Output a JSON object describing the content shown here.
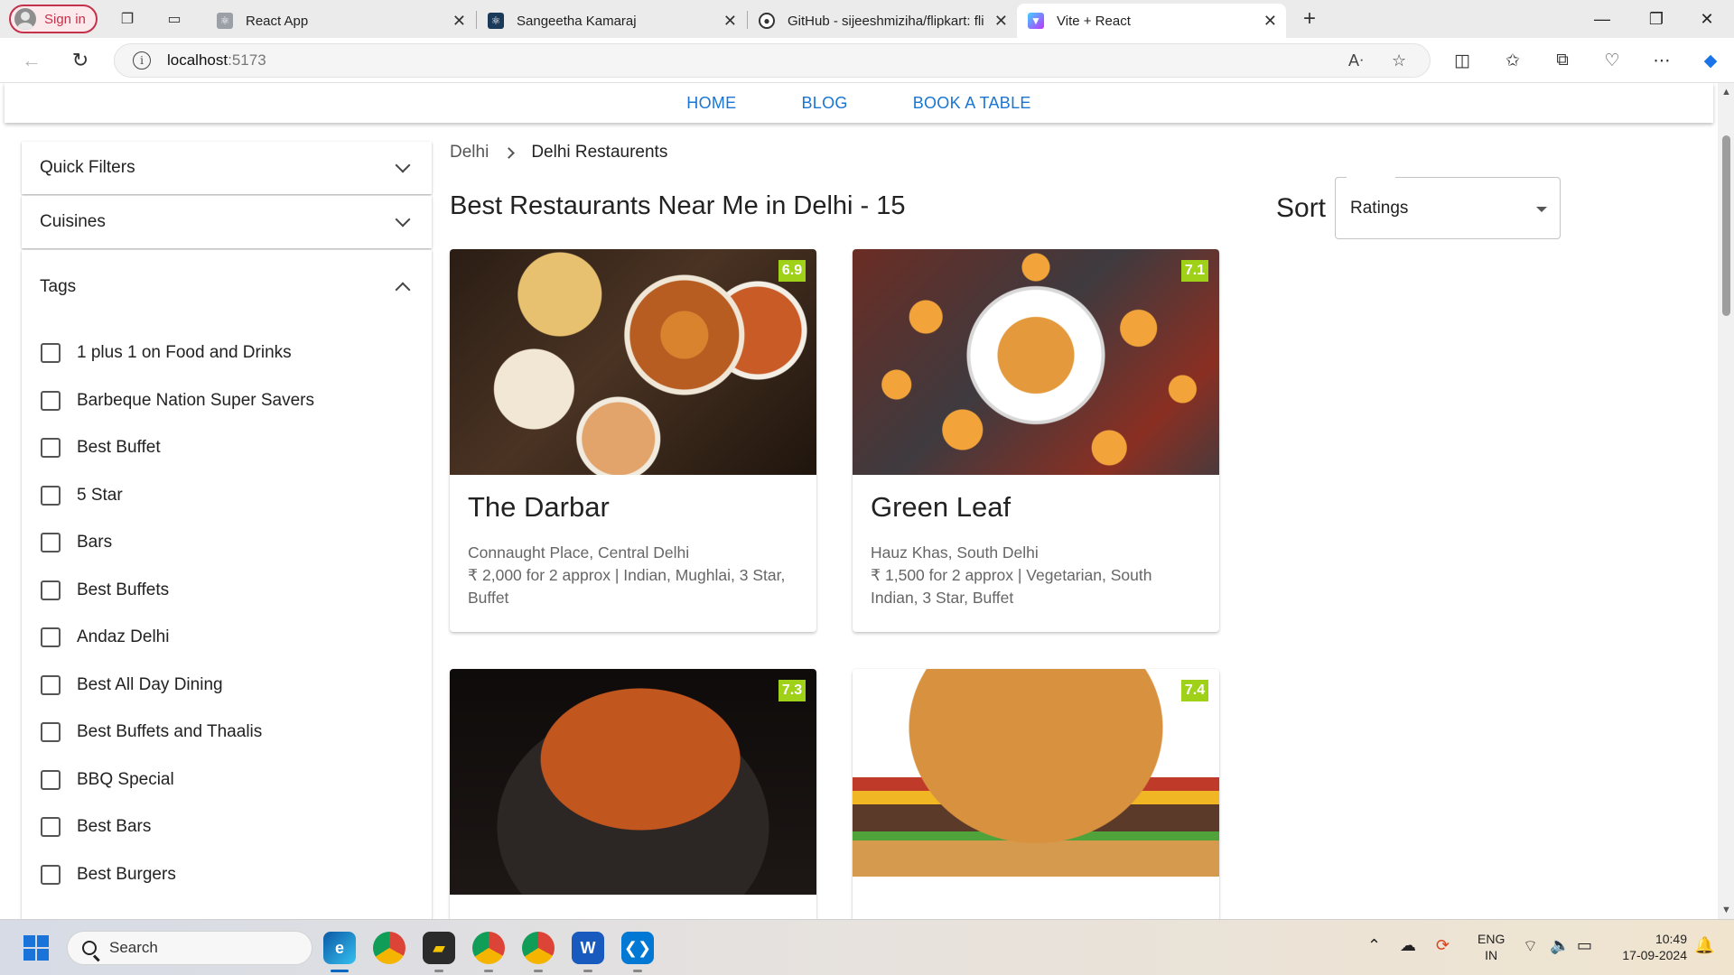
{
  "browser": {
    "signin_label": "Sign in",
    "tabs": [
      {
        "title": "React App"
      },
      {
        "title": "Sangeetha Kamaraj"
      },
      {
        "title": "GitHub - sijeeshmiziha/flipkart: fli"
      },
      {
        "title": "Vite + React"
      }
    ],
    "address_host": "localhost",
    "address_port": ":5173"
  },
  "nav": {
    "links": [
      "HOME",
      "BLOG",
      "BOOK A TABLE"
    ]
  },
  "sidebar": {
    "quick_filters": "Quick Filters",
    "cuisines": "Cuisines",
    "tags_title": "Tags",
    "tags": [
      "1 plus 1 on Food and Drinks",
      "Barbeque Nation Super Savers",
      "Best Buffet",
      "5 Star",
      "Bars",
      "Best Buffets",
      "Andaz Delhi",
      "Best All Day Dining",
      "Best Buffets and Thaalis",
      "BBQ Special",
      "Best Bars",
      "Best Burgers"
    ]
  },
  "main": {
    "breadcrumb": [
      "Delhi",
      "Delhi Restaurents"
    ],
    "heading": "Best Restaurants Near Me in Delhi - 15",
    "sort_label": "Sort",
    "sort_value": "Ratings",
    "restaurants": [
      {
        "name": "The Darbar",
        "rating": "6.9",
        "location": "Connaught Place, Central Delhi",
        "info": "₹ 2,000 for 2 approx | Indian, Mughlai, 3 Star, Buffet"
      },
      {
        "name": "Green Leaf",
        "rating": "7.1",
        "location": "Hauz Khas, South Delhi",
        "info": "₹ 1,500 for 2 approx | Vegetarian, South Indian, 3 Star, Buffet"
      },
      {
        "name": "",
        "rating": "7.3",
        "location": "",
        "info": ""
      },
      {
        "name": "",
        "rating": "7.4",
        "location": "",
        "info": ""
      }
    ]
  },
  "taskbar": {
    "search_label": "Search",
    "lang": [
      "ENG",
      "IN"
    ],
    "time": "10:49",
    "date": "17-09-2024"
  },
  "colors": {
    "accent": "#1976d2",
    "rating_badge": "#9ed117"
  }
}
